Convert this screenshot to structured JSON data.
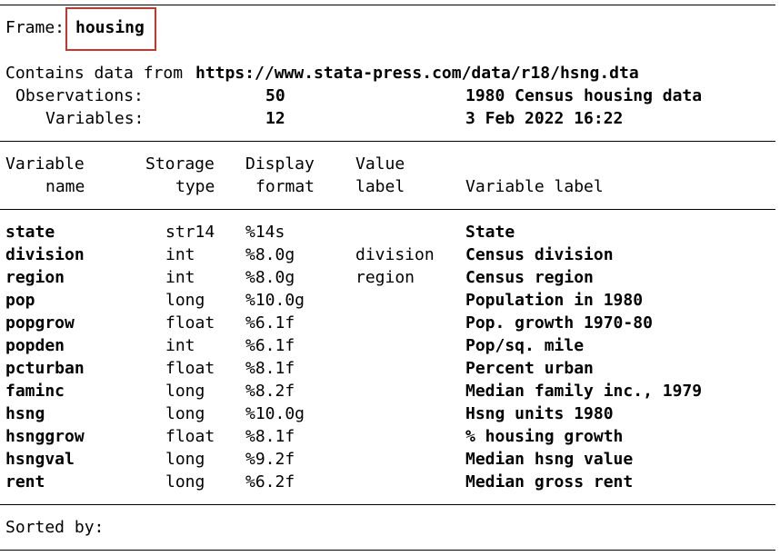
{
  "frame": {
    "label": "Frame:",
    "name": "housing"
  },
  "header": {
    "contains_prefix": "Contains data from",
    "source": "https://www.stata-press.com/data/r18/hsng.dta",
    "obs_label": "Observations:",
    "obs_value": "50",
    "dataset_label": "1980 Census housing data",
    "vars_label": "Variables:",
    "vars_value": "12",
    "timestamp": "3 Feb 2022 16:22"
  },
  "columns": {
    "variable": "Variable",
    "name": "name",
    "storage": "Storage",
    "type": "type",
    "display": "Display",
    "format": "format",
    "value": "Value",
    "vlabel": "label",
    "variable_label": "Variable label"
  },
  "variables": [
    {
      "name": "state",
      "type": "str14",
      "format": "%14s",
      "value_label": "",
      "label": "State"
    },
    {
      "name": "division",
      "type": "int",
      "format": "%8.0g",
      "value_label": "division",
      "label": "Census division"
    },
    {
      "name": "region",
      "type": "int",
      "format": "%8.0g",
      "value_label": "region",
      "label": "Census region"
    },
    {
      "name": "pop",
      "type": "long",
      "format": "%10.0g",
      "value_label": "",
      "label": "Population in 1980"
    },
    {
      "name": "popgrow",
      "type": "float",
      "format": "%6.1f",
      "value_label": "",
      "label": "Pop. growth 1970-80"
    },
    {
      "name": "popden",
      "type": "int",
      "format": "%6.1f",
      "value_label": "",
      "label": "Pop/sq. mile"
    },
    {
      "name": "pcturban",
      "type": "float",
      "format": "%8.1f",
      "value_label": "",
      "label": "Percent urban"
    },
    {
      "name": "faminc",
      "type": "long",
      "format": "%8.2f",
      "value_label": "",
      "label": "Median family inc., 1979"
    },
    {
      "name": "hsng",
      "type": "long",
      "format": "%10.0g",
      "value_label": "",
      "label": "Hsng units 1980"
    },
    {
      "name": "hsnggrow",
      "type": "float",
      "format": "%8.1f",
      "value_label": "",
      "label": "% housing growth"
    },
    {
      "name": "hsngval",
      "type": "long",
      "format": "%9.2f",
      "value_label": "",
      "label": "Median hsng value"
    },
    {
      "name": "rent",
      "type": "long",
      "format": "%6.2f",
      "value_label": "",
      "label": "Median gross rent"
    }
  ],
  "footer": {
    "sorted_label": "Sorted by:"
  },
  "colors": {
    "highlight": "#c0392b"
  }
}
